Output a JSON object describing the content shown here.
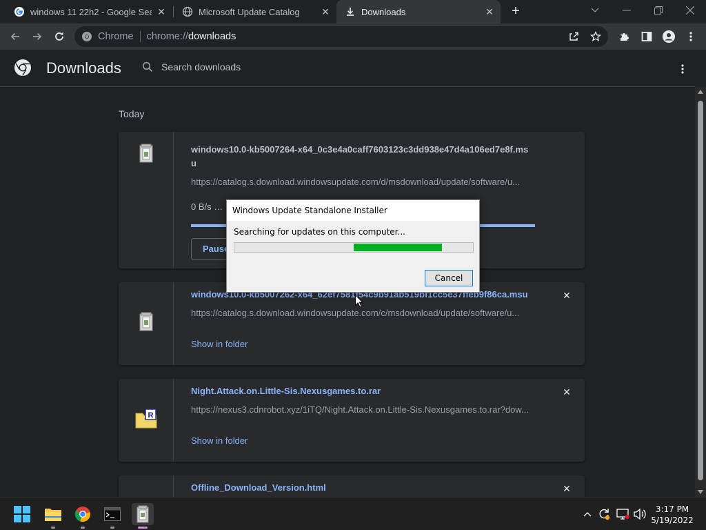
{
  "tabs": [
    {
      "label": "windows 11 22h2 - Google Search",
      "icon": "google-icon"
    },
    {
      "label": "Microsoft Update Catalog",
      "icon": "globe-icon"
    },
    {
      "label": "Downloads",
      "icon": "download-icon"
    }
  ],
  "omnibox": {
    "site": "Chrome",
    "scheme": "chrome://",
    "host": "downloads"
  },
  "downloads_page": {
    "title": "Downloads",
    "search_placeholder": "Search downloads",
    "date_group": "Today",
    "items": [
      {
        "filename": "windows10.0-kb5007264-x64_0c3e4a0caff7603123c3dd938e47d4a106ed7e8f.msu",
        "url": "https://catalog.s.download.windowsupdate.com/d/msdownload/update/software/u...",
        "status": "0 B/s - 17",
        "progress_fraction": 1.0,
        "action": "Pause",
        "icon": "msu-package-icon"
      },
      {
        "filename": "windows10.0-kb5007262-x64_62ef7581f54c9b91ab519bf1cc5e37ffeb9f86ca.msu",
        "url": "https://catalog.s.download.windowsupdate.com/c/msdownload/update/software/u...",
        "action": "Show in folder",
        "icon": "msu-package-icon"
      },
      {
        "filename": "Night.Attack.on.Little-Sis.Nexusgames.to.rar",
        "url": "https://nexus3.cdnrobot.xyz/1iTQ/Night.Attack.on.Little-Sis.Nexusgames.to.rar?dow...",
        "action": "Show in folder",
        "icon": "rar-archive-icon"
      },
      {
        "filename": "Offline_Download_Version.html",
        "icon": "html-file-icon"
      }
    ]
  },
  "dialog": {
    "title": "Windows Update Standalone Installer",
    "message": "Searching for updates on this computer...",
    "progress_fill_start": 0.5,
    "progress_fill_end": 0.87,
    "cancel_label": "Cancel"
  },
  "clock": {
    "time": "3:17 PM",
    "date": "5/19/2022"
  },
  "colors": {
    "accent_link": "#8ab4f8",
    "progress_green": "#06b025",
    "page_bg": "#202124"
  }
}
